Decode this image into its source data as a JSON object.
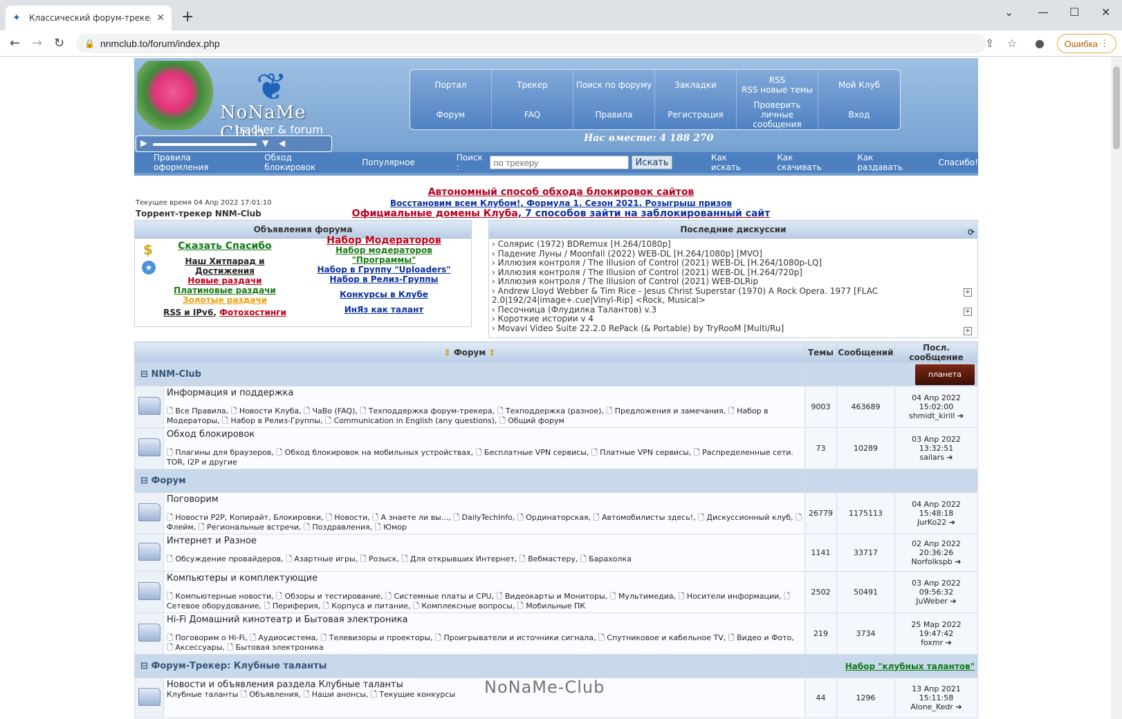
{
  "browser": {
    "tab_title": "Классический форум-трекер :: N",
    "url": "nnmclub.to/forum/index.php",
    "error_label": "Ошибка"
  },
  "header": {
    "logo_title": "NoNaMe Club",
    "logo_sub": "tracker & forum",
    "menu": [
      "Портал",
      "Трекер",
      "Поиск по форуму",
      "Закладки",
      "RSS\nRSS новые темы",
      "Мой Клуб",
      "Форум",
      "FAQ",
      "Правила",
      "Регистрация",
      "Проверить личные сообщения",
      "Вход"
    ],
    "together": "Нас вместе: 4 188 270",
    "subnav_left": [
      "Правила оформления",
      "Обход блокировок",
      "Популярное"
    ],
    "search_label": "Поиск :",
    "search_placeholder": "по трекеру",
    "search_button": "Искать",
    "subnav_right": [
      "Как искать",
      "Как скачивать",
      "Как раздавать",
      "Спасибо!"
    ]
  },
  "info": {
    "time": "Текущее время 04 Апр 2022 17:01:10",
    "tracker": "Торрент-трекер NNM-Club",
    "ann1": "Автономный способ обхода блокировок сайтов",
    "ann2a": "Восстановим всем Клубом!",
    "ann2b": "Формула 1. Сезон 2021. Розыгрыш призов",
    "ann3a": "Официальные домены Клуба",
    "ann3b": "7 способов зайти на заблокированный сайт"
  },
  "announcements": {
    "title": "Объявления форума",
    "col1": [
      "Сказать Спасибо",
      "Наш Хитпарад и Достижения",
      "Новые раздачи",
      "Платиновые раздачи",
      "Золотые раздачи",
      "RSS и IPv6",
      "Фотохостинги"
    ],
    "col2": [
      "Набор Модераторов",
      "Набор модераторов \"Программы\"",
      "Набор в Группу \"Uploaders\"",
      "Набор в Релиз-Группы",
      "Конкурсы в Клубе",
      "ИнЯз как талант"
    ]
  },
  "discussions": {
    "title": "Последние дискуссии",
    "items": [
      "Солярис (1972) BDRemux [H.264/1080p]",
      "Падение Луны / Moonfall (2022) WEB-DL [H.264/1080p] [MVO]",
      "Иллюзия контроля / The Illusion of Control (2021) WEB-DL [H.264/1080p-LQ]",
      "Иллюзия контроля / The Illusion of Control (2021) WEB-DL [H.264/720p]",
      "Иллюзия контроля / The Illusion of Control (2021) WEB-DLRip",
      "Andrew Lloyd Webber & Tim Rice - Jesus Christ Superstar (1970) A Rock Opera. 1977 [FLAC 2.0|192/24|image+.cue|Vinyl-Rip] <Rock, Musical>",
      "Песочница (Флудилка Талантов) v.3",
      "Короткие истории v 4",
      "Movavi Video Suite 22.2.0 RePack (& Portable) by TryRooM [Multi/Ru]"
    ]
  },
  "table": {
    "head": [
      "Форум",
      "Темы",
      "Сообщений",
      "Посл. сообщение"
    ],
    "cat1": "NNM-Club",
    "cat1_banner": "планета",
    "cat2": "Форум",
    "cat3": "Форум-Трекер: Клубные таланты",
    "cat3_link": "Набор \"клубных талантов\"",
    "rows": [
      {
        "name": "Информация и поддержка",
        "subs": "Все Правила, 🗋 Новости Клуба, 🗋 ЧаВо (FAQ), 🗋 Техподдержка форум-трекера, 🗋 Техподдержка (разное), 🗋 Предложения и замечания, 🗋 Набор в Модераторы, 🗋 Набор в Релиз-Группы, 🗋 Communication in English (any questions), 🗋 Общий форум",
        "topics": "9003",
        "posts": "463689",
        "last_date": "04 Апр 2022 15:02:00",
        "last_user": "shmidt_kirill"
      },
      {
        "name": "Обход блокировок",
        "subs": "Плагины для браузеров, 🗋 Обход блокировок на мобильных устройствах, 🗋 Бесплатные VPN сервисы, 🗋 Платные VPN сервисы, 🗋 Распределенные сети. TOR, I2P и другие",
        "topics": "73",
        "posts": "10289",
        "last_date": "03 Апр 2022 13:32:51",
        "last_user": "sailars"
      },
      {
        "name": "Поговорим",
        "subs": "Новости P2P, Копирайт, Блокировки, 🗋 Новости, 🗋 А знаете ли вы..., 🗋 DailyTechInfo, 🗋 Ординаторская, 🗋 Автомобилисты здесь!, 🗋 Дискуссионный клуб, 🗋 Флейм, 🗋 Региональные встречи, 🗋 Поздравления, 🗋 Юмор",
        "topics": "26779",
        "posts": "1175113",
        "last_date": "04 Апр 2022 15:48:18",
        "last_user": "JurKo22"
      },
      {
        "name": "Интернет и Разное",
        "subs": "Обсуждение провайдеров, 🗋 Азартные игры, 🗋 Розыск, 🗋 Для открывших Интернет, 🗋 Вебмастеру, 🗋 Барахолка",
        "topics": "1141",
        "posts": "33717",
        "last_date": "02 Апр 2022 20:36:26",
        "last_user": "Norfolkspb"
      },
      {
        "name": "Компьютеры и комплектующие",
        "subs": "Компьютерные новости, 🗋 Обзоры и тестирование, 🗋 Системные платы и CPU, 🗋 Видеокарты и Мониторы, 🗋 Мультимедиа, 🗋 Носители информации, 🗋 Сетевое оборудование, 🗋 Периферия, 🗋 Корпуса и питание, 🗋 Комплексные вопросы, 🗋 Мобильные ПК",
        "topics": "2502",
        "posts": "50491",
        "last_date": "03 Апр 2022 09:56:32",
        "last_user": "JuWeber"
      },
      {
        "name": "Hi-Fi Домашний кинотеатр и Бытовая электроника",
        "subs": "Поговорим о Hi-Fi, 🗋 Аудиосистема, 🗋 Телевизоры и проекторы, 🗋 Проигрыватели и источники сигнала, 🗋 Спутниковое и кабельное TV, 🗋 Видео и Фото, 🗋 Аксессуары, 🗋 Бытовая электроника",
        "topics": "219",
        "posts": "3734",
        "last_date": "25 Мар 2022 19:47:42",
        "last_user": "foxmr"
      },
      {
        "name": "Новости и объявления раздела Клубные таланты",
        "subs": "Клубные таланты 🗋 Объявления, 🗋 Наши анонсы, 🗋 Текущие конкурсы",
        "topics": "44",
        "posts": "1296",
        "last_date": "13 Апр 2021 15:11:58",
        "last_user": "Alone_Kedr"
      }
    ]
  },
  "watermark": "NoNaMe-Club"
}
